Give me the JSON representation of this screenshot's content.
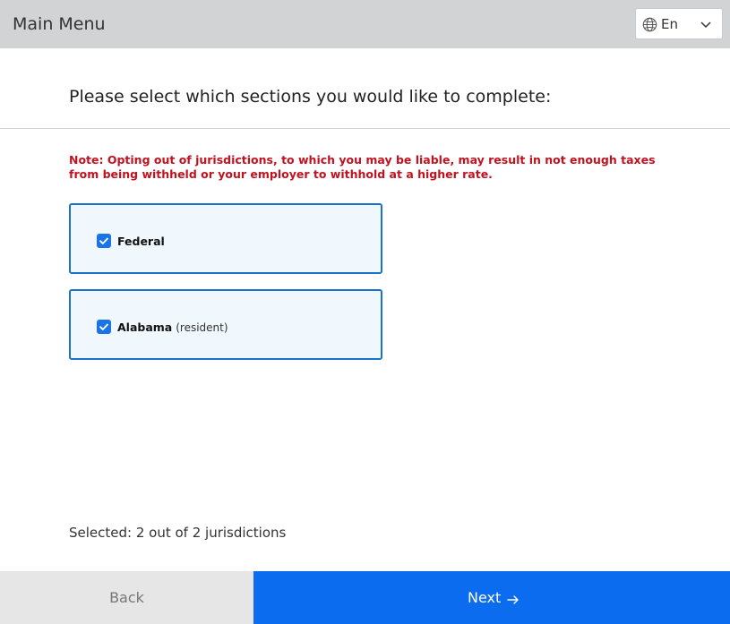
{
  "header": {
    "title": "Main Menu",
    "language": {
      "selected": "En",
      "icon": "globe-icon",
      "dropdown_icon": "chevron-down-icon"
    }
  },
  "main": {
    "heading": "Please select which sections you would like to complete:",
    "note": "Note: Opting out of jurisdictions, to which you may be liable, may result in not enough taxes from being withheld or your employer to withhold at a higher rate.",
    "jurisdictions": [
      {
        "name": "Federal",
        "qualifier": "",
        "checked": true
      },
      {
        "name": "Alabama",
        "qualifier": "(resident)",
        "checked": true
      }
    ],
    "selected_summary": "Selected: 2 out of 2 jurisdictions"
  },
  "footer": {
    "back_label": "Back",
    "next_label": "Next",
    "next_icon": "arrow-right-icon"
  },
  "colors": {
    "header_bg": "#d2d3d5",
    "accent": "#0b6cf0",
    "card_border": "#1a73c9",
    "card_bg": "#f0f7fd",
    "note_text": "#c1121f",
    "back_bg": "#e6e6e6"
  }
}
